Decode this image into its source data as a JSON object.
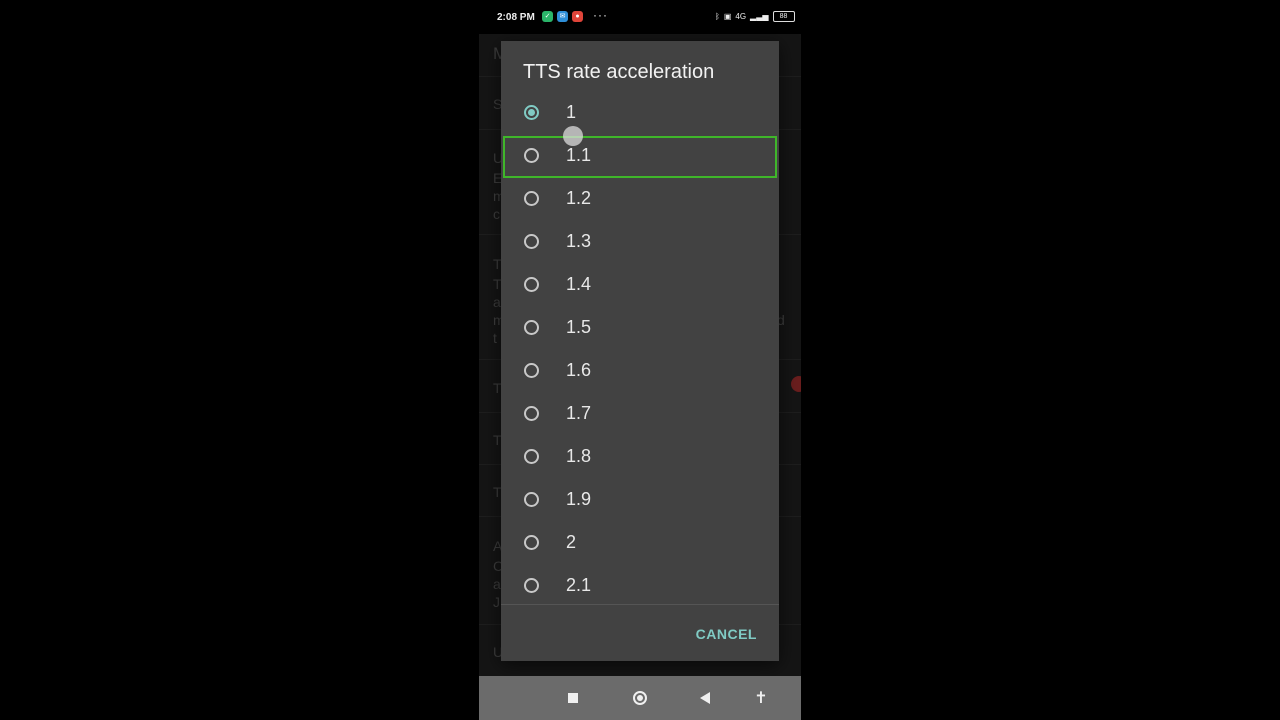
{
  "status_bar": {
    "time": "2:08 PM",
    "more": "···",
    "network": "4G",
    "battery": "88"
  },
  "background": {
    "rows": [
      "M",
      "S",
      "U",
      "E",
      "m",
      "c",
      "T",
      "T",
      "a",
      "m",
      "d",
      "t",
      "T",
      "T",
      "T",
      "A",
      "C",
      "a",
      "J",
      "U"
    ]
  },
  "dialog": {
    "title": "TTS rate acceleration",
    "options": [
      {
        "label": "1",
        "checked": true
      },
      {
        "label": "1.1",
        "checked": false
      },
      {
        "label": "1.2",
        "checked": false
      },
      {
        "label": "1.3",
        "checked": false
      },
      {
        "label": "1.4",
        "checked": false
      },
      {
        "label": "1.5",
        "checked": false
      },
      {
        "label": "1.6",
        "checked": false
      },
      {
        "label": "1.7",
        "checked": false
      },
      {
        "label": "1.8",
        "checked": false
      },
      {
        "label": "1.9",
        "checked": false
      },
      {
        "label": "2",
        "checked": false
      },
      {
        "label": "2.1",
        "checked": false
      }
    ],
    "cancel_label": "CANCEL"
  },
  "colors": {
    "accent": "#80cbc4",
    "focus": "#3fb62a",
    "dialog_bg": "#424242"
  }
}
